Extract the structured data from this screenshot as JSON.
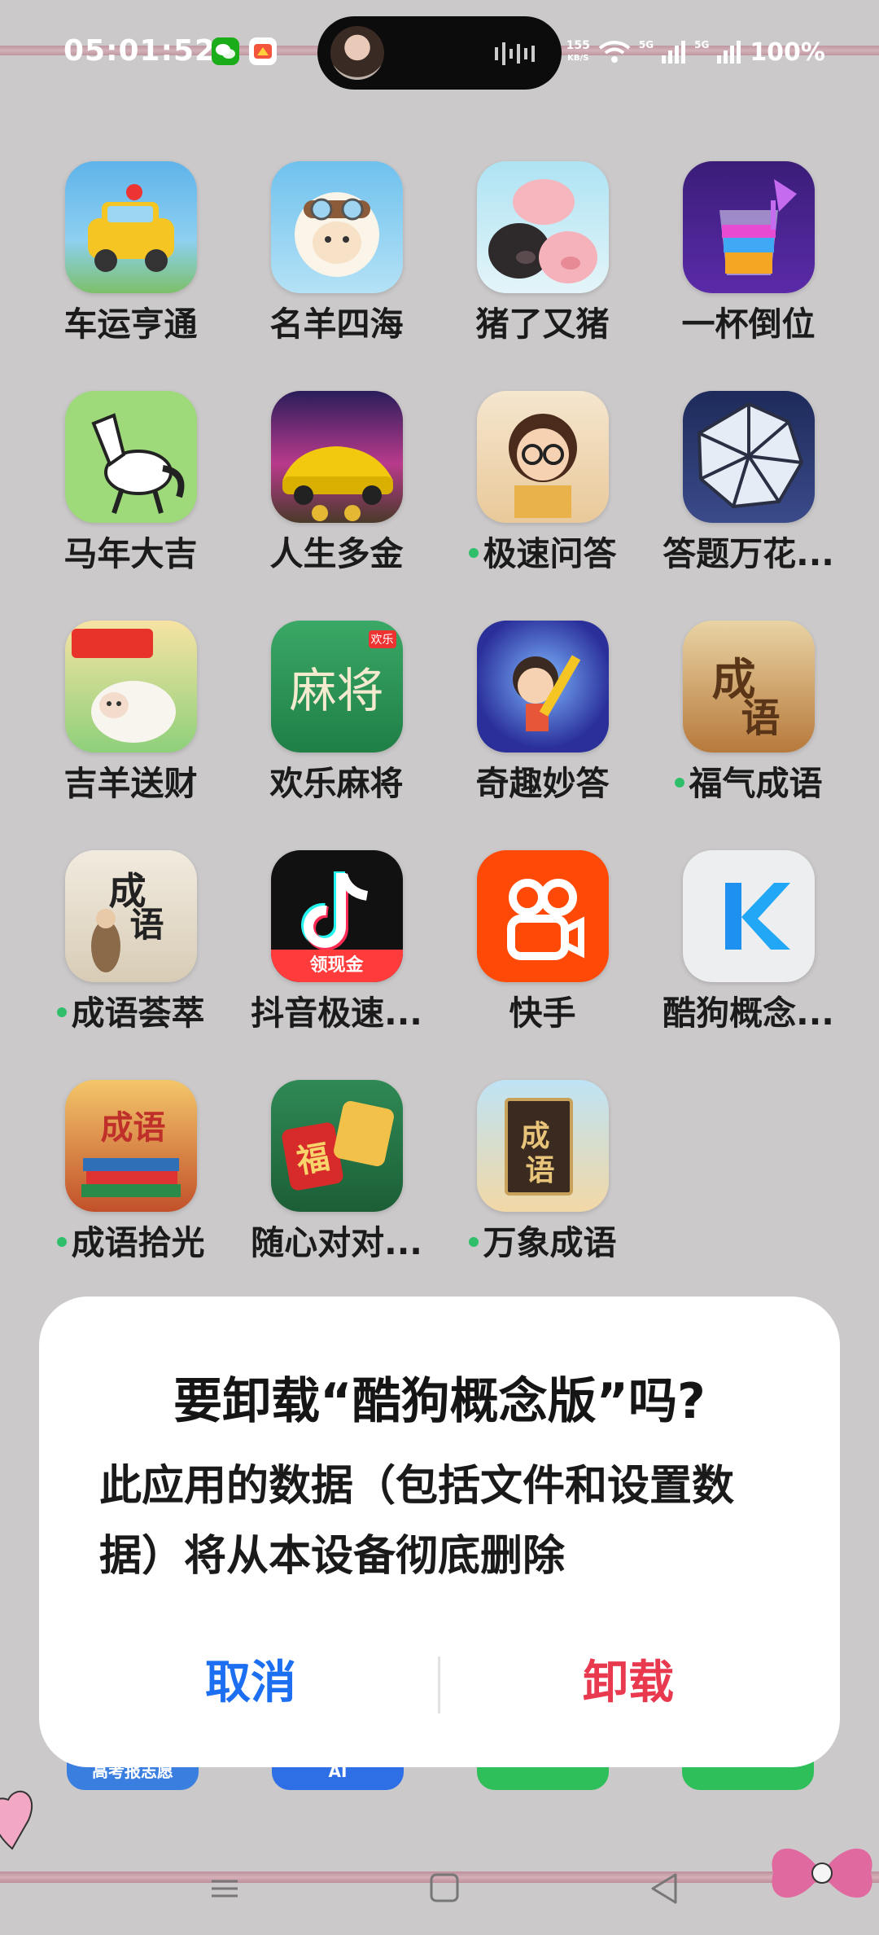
{
  "status_bar": {
    "time": "05:01:52",
    "net_speed_value": "155",
    "net_speed_unit": "KB/S",
    "signal_1": "5G",
    "signal_2": "5G",
    "battery": "100%",
    "notifications": [
      "wechat-icon",
      "app-notification-icon"
    ]
  },
  "apps": [
    {
      "label": "车运亨通",
      "icon": "car-cartoon-icon",
      "dot": false
    },
    {
      "label": "名羊四海",
      "icon": "sheep-pilot-icon",
      "dot": false
    },
    {
      "label": "猪了又猪",
      "icon": "pigs-icon",
      "dot": false
    },
    {
      "label": "一杯倒位",
      "icon": "cup-pour-icon",
      "dot": false
    },
    {
      "label": "马年大吉",
      "icon": "horse-icon",
      "dot": false
    },
    {
      "label": "人生多金",
      "icon": "sports-car-icon",
      "dot": false
    },
    {
      "label": "极速问答",
      "icon": "girl-quiz-icon",
      "dot": true
    },
    {
      "label": "答题万花...",
      "icon": "kaleidoscope-icon",
      "dot": false
    },
    {
      "label": "吉羊送财",
      "icon": "sheep-fortune-icon",
      "dot": false
    },
    {
      "label": "欢乐麻将",
      "icon": "mahjong-icon",
      "dot": false
    },
    {
      "label": "奇趣妙答",
      "icon": "pencil-boy-icon",
      "dot": false
    },
    {
      "label": "福气成语",
      "icon": "idiom-scroll-icon",
      "dot": true
    },
    {
      "label": "成语荟萃",
      "icon": "idiom-sage-icon",
      "dot": true
    },
    {
      "label": "抖音极速...",
      "icon": "douyin-icon",
      "dot": false
    },
    {
      "label": "快手",
      "icon": "kuaishou-icon",
      "dot": false
    },
    {
      "label": "酷狗概念...",
      "icon": "kugou-icon",
      "dot": false
    },
    {
      "label": "成语拾光",
      "icon": "idiom-books-icon",
      "dot": true
    },
    {
      "label": "随心对对...",
      "icon": "fu-tiles-icon",
      "dot": false
    },
    {
      "label": "万象成语",
      "icon": "idiom-book-icon",
      "dot": true
    }
  ],
  "icon_text": {
    "mahjong": "麻将",
    "mahjong_tag": "欢乐",
    "idiom_1": "成",
    "idiom_2": "语",
    "douyin_badge": "领现金",
    "fu": "福"
  },
  "dock_hints": [
    "高考报志愿",
    "AI"
  ],
  "dialog": {
    "title": "要卸载“酷狗概念版”吗?",
    "message": "此应用的数据（包括文件和设置数据）将从本设备彻底删除",
    "cancel_label": "取消",
    "confirm_label": "卸载"
  },
  "colors": {
    "cancel": "#1d6ff2",
    "confirm": "#e8394e",
    "dot": "#2fbf6a"
  }
}
